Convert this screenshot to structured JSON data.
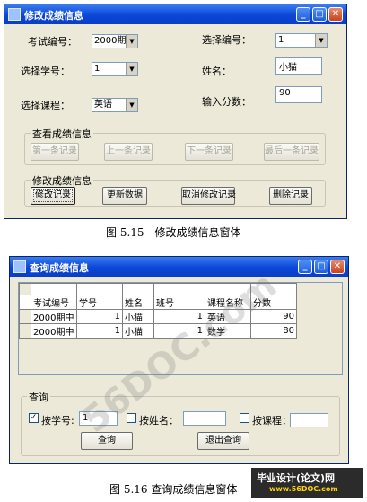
{
  "modify_window": {
    "title": "修改成绩信息",
    "exam_no_label": "考试编号：",
    "exam_no_value": "2000期中",
    "select_no_label": "选择编号：",
    "select_no_value": "1",
    "student_no_label": "选择学号：",
    "student_no_value": "1",
    "name_label": "姓名：",
    "name_value": "小猫",
    "course_label": "选择课程：",
    "course_value": "英语",
    "score_label": "输入分数：",
    "score_value": "90",
    "view_group_title": "查看成绩信息",
    "first_btn": "第一条记录",
    "prev_btn": "上一条记录",
    "next_btn": "下一条记录",
    "last_btn": "最后一条记录",
    "modify_group_title": "修改成绩信息",
    "modify_btn": "修改记录",
    "update_btn": "更新数据",
    "cancel_btn": "取消修改记录",
    "delete_btn": "删除记录"
  },
  "caption1": "图 5.15　修改成绩信息窗体",
  "query_window": {
    "title": "查询成绩信息",
    "columns": [
      "考试编号",
      "学号",
      "姓名",
      "班号",
      "课程名称",
      "分数"
    ],
    "rows": [
      [
        "2000期中",
        "1",
        "小猫",
        "1",
        "英语",
        "90"
      ],
      [
        "2000期中",
        "1",
        "小猫",
        "1",
        "数学",
        "80"
      ]
    ],
    "query_group_title": "查询",
    "by_student_label": "按学号:",
    "by_student_value": "1",
    "by_student_checked": true,
    "by_name_label": "按姓名：",
    "by_course_label": "按课程：",
    "query_btn": "查询",
    "exit_btn": "退出查询"
  },
  "caption2": "图 5.16 查询成绩信息窗体",
  "watermark": "56DOC.com",
  "badge": {
    "line1": "毕业设计(论文)网",
    "line2": "www.56DOC.com"
  }
}
